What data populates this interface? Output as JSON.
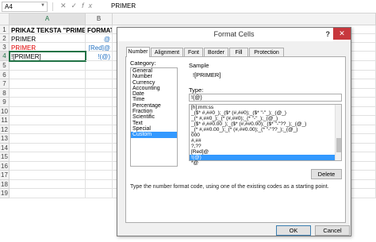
{
  "formula_bar": {
    "namebox": "A4",
    "cancel": "✕",
    "enter": "✓",
    "fx": "fx",
    "value": "PRIMER"
  },
  "columns": [
    "A",
    "B"
  ],
  "rows": [
    "1",
    "2",
    "3",
    "4",
    "5",
    "6",
    "7",
    "8",
    "9",
    "10",
    "11",
    "12",
    "13",
    "14",
    "15",
    "16",
    "17",
    "18",
    "19"
  ],
  "cells": {
    "a1": "PRIKAZ TEKSTA \"PRIMER\"",
    "b1": "FORMAT",
    "a2": "PRIMER",
    "b2": "@",
    "a3": "PRIMER",
    "b3": "[Red]@",
    "a4": "![PRIMER]",
    "b4": "!(@)"
  },
  "colors": {
    "red_text": "#e00000",
    "blue_text": "#1f6fc1",
    "selection": "#3399ff",
    "close_button": "#c7383d",
    "excel_green": "#217346"
  },
  "dialog": {
    "title": "Format Cells",
    "help": "?",
    "close": "✕",
    "tabs": [
      "Number",
      "Alignment",
      "Font",
      "Border",
      "Fill",
      "Protection"
    ],
    "category_label": "Category:",
    "categories": [
      "General",
      "Number",
      "Currency",
      "Accounting",
      "Date",
      "Time",
      "Percentage",
      "Fraction",
      "Scientific",
      "Text",
      "Special",
      "Custom"
    ],
    "selected_category": "Custom",
    "sample_label": "Sample",
    "sample_value": "![PRIMER]",
    "type_label": "Type:",
    "type_value": "!(@)",
    "codes": [
      "[h]:mm:ss",
      "_($* #,##0_);_($* (#,##0);_($* \"-\"_);_(@_)",
      "_(* #,##0_);_(* (#,##0);_(* \"-\"_);_(@_)",
      "_($* #,##0.00_);_($* (#,##0.00);_($* \"-\"??_);_(@_)",
      "_(* #,##0.00_);_(* (#,##0.00);_(* \"-\"??_);_(@_)",
      "000",
      "#,##",
      "?,??",
      "[Red]@",
      "!(@)",
      "*@"
    ],
    "selected_code": "!(@)",
    "delete_button": "Delete",
    "hint": "Type the number format code, using one of the existing codes as a starting point.",
    "ok_button": "OK",
    "cancel_button": "Cancel"
  }
}
